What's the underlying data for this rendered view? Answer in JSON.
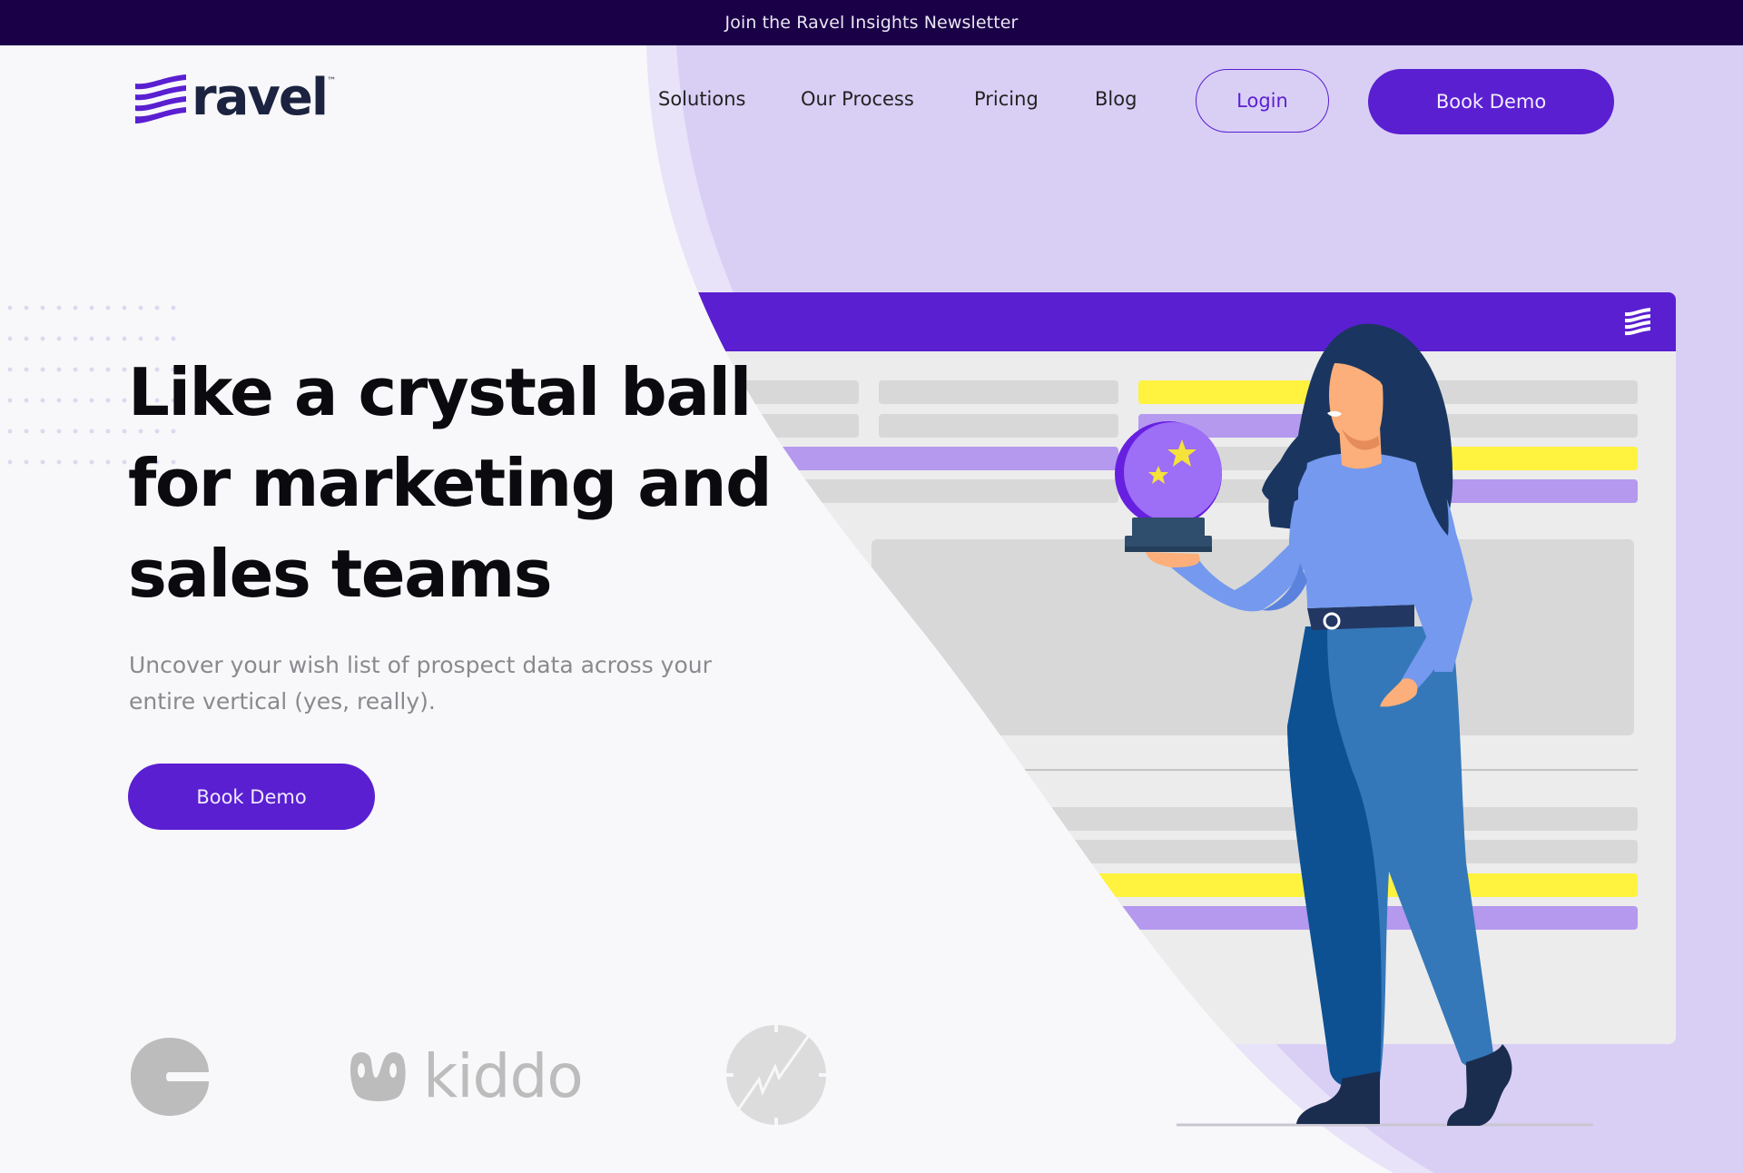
{
  "announcement": {
    "text": "Join the Ravel Insights Newsletter"
  },
  "brand": {
    "name": "ravel",
    "trademark": "™",
    "colors": {
      "primary": "#5a1fd1",
      "dark_bar": "#1a0047",
      "lavender_bg": "#d9cff5",
      "text_dark": "#0b0b0f",
      "text_muted": "#8a8a8e"
    }
  },
  "nav": {
    "items": [
      {
        "label": "Solutions"
      },
      {
        "label": "Our Process"
      },
      {
        "label": "Pricing"
      },
      {
        "label": "Blog"
      }
    ],
    "login_label": "Login",
    "book_demo_label": "Book Demo"
  },
  "hero": {
    "headline_lines": [
      "Like a crystal ball",
      "for marketing and",
      "sales teams"
    ],
    "subtext_lines": [
      "Uncover your wish list of prospect data across your",
      "entire vertical (yes, really)."
    ],
    "cta_label": "Book Demo",
    "illustration": "woman-holding-crystal-ball-over-dashboard"
  },
  "clients": {
    "logos": [
      {
        "name": "client-c-logo"
      },
      {
        "name": "kiddo",
        "label": "kiddo"
      },
      {
        "name": "client-trend-logo"
      }
    ]
  }
}
